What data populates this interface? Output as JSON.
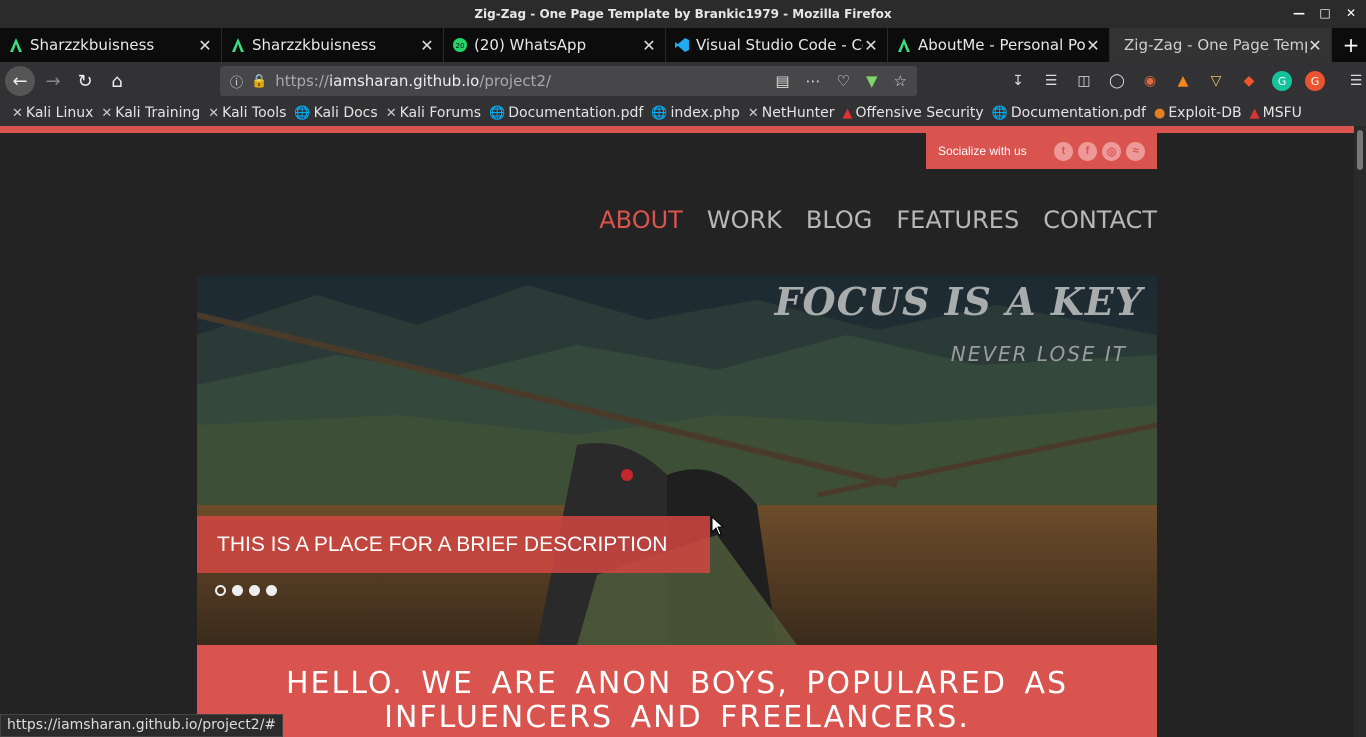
{
  "window": {
    "title": "Zig-Zag - One Page Template by Brankic1979 - Mozilla Firefox"
  },
  "tabs": [
    {
      "label": "Sharzzkbuisness",
      "icon": "androidstudio-a-icon"
    },
    {
      "label": "Sharzzkbuisness",
      "icon": "androidstudio-a-icon"
    },
    {
      "label": "(20) WhatsApp",
      "icon": "whatsapp-icon"
    },
    {
      "label": "Visual Studio Code - Cod",
      "icon": "vscode-icon"
    },
    {
      "label": "AboutMe - Personal Port",
      "icon": "androidstudio-a-icon"
    },
    {
      "label": "Zig-Zag - One Page Templa",
      "icon": "none"
    }
  ],
  "url": {
    "prefix": "https://",
    "host": "iamsharan.github.io",
    "path": "/project2/"
  },
  "bookmarks": [
    {
      "label": "Kali Linux"
    },
    {
      "label": "Kali Training"
    },
    {
      "label": "Kali Tools"
    },
    {
      "label": "Kali Docs"
    },
    {
      "label": "Kali Forums"
    },
    {
      "label": "Documentation.pdf"
    },
    {
      "label": "index.php"
    },
    {
      "label": "NetHunter"
    },
    {
      "label": "Offensive Security"
    },
    {
      "label": "Documentation.pdf"
    },
    {
      "label": "Exploit-DB"
    },
    {
      "label": "MSFU"
    }
  ],
  "site": {
    "social_label": "Socialize with us",
    "nav": [
      "ABOUT",
      "WORK",
      "BLOG",
      "FEATURES",
      "CONTACT"
    ],
    "hero_title": "FOCUS IS A KEY",
    "hero_subtitle": "NEVER LOSE IT",
    "caption": "THIS IS A PLACE FOR A BRIEF DESCRIPTION",
    "hello": "HELLO. WE ARE ANON BOYS, POPULARED AS INFLUENCERS AND FREELANCERS."
  },
  "status": {
    "link": "https://iamsharan.github.io/project2/#"
  },
  "colors": {
    "accent": "#d9534f"
  }
}
